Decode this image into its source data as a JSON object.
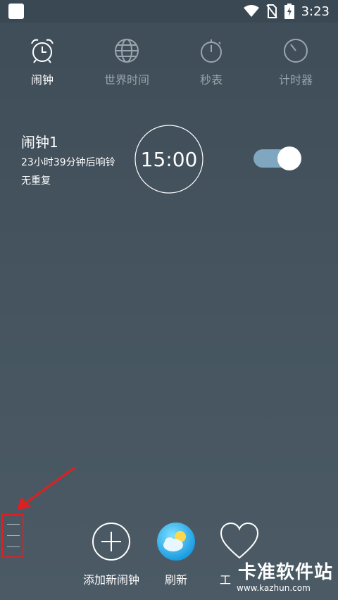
{
  "status_bar": {
    "time": "3:23",
    "icons": [
      "app-icon",
      "wifi-icon",
      "no-sim-icon",
      "battery-charging-icon"
    ]
  },
  "tabs": [
    {
      "label": "闹钟",
      "icon": "alarm-clock-icon",
      "active": true
    },
    {
      "label": "世界时间",
      "icon": "globe-icon",
      "active": false
    },
    {
      "label": "秒表",
      "icon": "stopwatch-icon",
      "active": false
    },
    {
      "label": "计时器",
      "icon": "timer-icon",
      "active": false
    }
  ],
  "alarm": {
    "name": "闹钟1",
    "remaining": "23小时39分钟后响铃",
    "repeat": "无重复",
    "time": "15:00",
    "enabled": true
  },
  "bottom": {
    "add_label": "添加新闹钟",
    "refresh_label": "刷新",
    "third_label": "工"
  },
  "watermark": {
    "text": "卡准软件站",
    "url": "www.kazhun.com"
  },
  "colors": {
    "background": "#465560",
    "toggle_on": "#7fa7c0",
    "annotation": "#e02020"
  }
}
